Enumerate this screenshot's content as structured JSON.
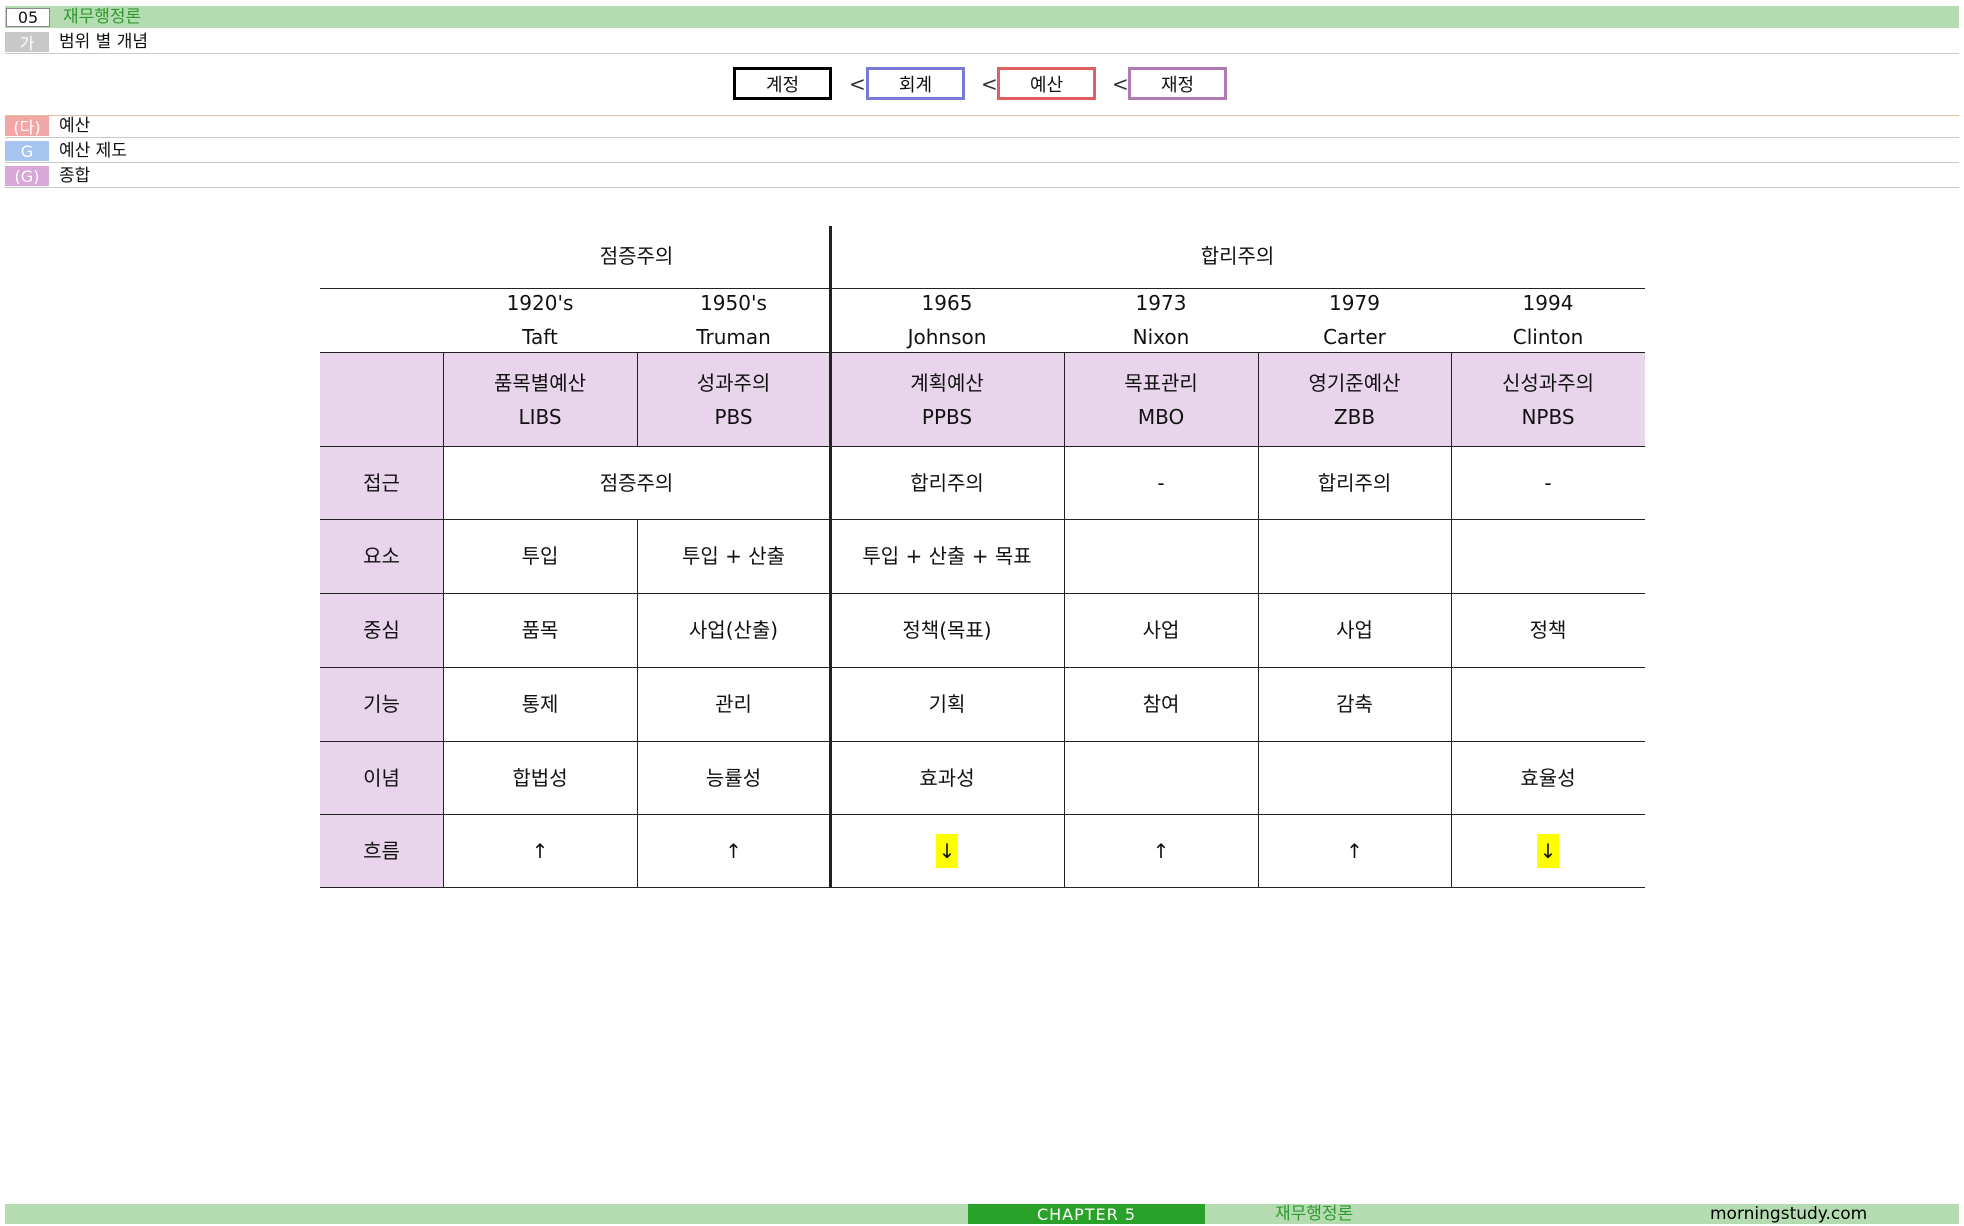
{
  "header": {
    "chapter_num": "05",
    "chapter_title": "재무행정론",
    "section_tag": "가",
    "section_title": "범위 별 개념"
  },
  "flow": {
    "boxes": [
      "계정",
      "회계",
      "예산",
      "재정"
    ],
    "separator": "<"
  },
  "subsections": [
    {
      "tag": "(다)",
      "title": "예산"
    },
    {
      "tag": "G",
      "title": "예산 제도"
    },
    {
      "tag": "(G)",
      "title": "종합"
    }
  ],
  "table": {
    "groups": [
      "점증주의",
      "합리주의"
    ],
    "years": [
      "1920's",
      "1950's",
      "1965",
      "1973",
      "1979",
      "1994"
    ],
    "presidents": [
      "Taft",
      "Truman",
      "Johnson",
      "Nixon",
      "Carter",
      "Clinton"
    ],
    "systems": [
      {
        "name": "품목별예산",
        "abbr": "LIBS"
      },
      {
        "name": "성과주의",
        "abbr": "PBS"
      },
      {
        "name": "계획예산",
        "abbr": "PPBS"
      },
      {
        "name": "목표관리",
        "abbr": "MBO"
      },
      {
        "name": "영기준예산",
        "abbr": "ZBB"
      },
      {
        "name": "신성과주의",
        "abbr": "NPBS"
      }
    ],
    "rows": [
      {
        "label": "접근",
        "approach_incremental": "점증주의",
        "cells": [
          "합리주의",
          "-",
          "합리주의",
          "-"
        ]
      },
      {
        "label": "요소",
        "cells": [
          "투입",
          "투입 + 산출",
          "투입 + 산출 + 목표",
          "",
          "",
          ""
        ]
      },
      {
        "label": "중심",
        "cells": [
          "품목",
          "사업(산출)",
          "정책(목표)",
          "사업",
          "사업",
          "정책"
        ]
      },
      {
        "label": "기능",
        "cells": [
          "통제",
          "관리",
          "기획",
          "참여",
          "감축",
          ""
        ]
      },
      {
        "label": "이념",
        "cells": [
          "합법성",
          "능률성",
          "효과성",
          "",
          "",
          "효율성"
        ]
      },
      {
        "label": "흐름",
        "cells": [
          "↑",
          "↑",
          "↓",
          "↑",
          "↑",
          "↓"
        ]
      }
    ]
  },
  "footer": {
    "chapter": "CHAPTER 5",
    "subject": "재무행정론",
    "site": "morningstudy.com"
  },
  "colors": {
    "header_green": "#b4dcb0",
    "chapter_text_green": "#2e9a2e",
    "footer_dark_green": "#2aa22a",
    "tag_gray": "#c8c8c8",
    "tag_red": "#f3a6a6",
    "tag_blue": "#a8c4f0",
    "tag_purple": "#d9a8d9",
    "row_head_purple": "#e9d5eb",
    "box_blue": "#7a7ad8",
    "box_red": "#e06060",
    "box_purple": "#b27ab2",
    "highlight_yellow": "#ffff00"
  }
}
